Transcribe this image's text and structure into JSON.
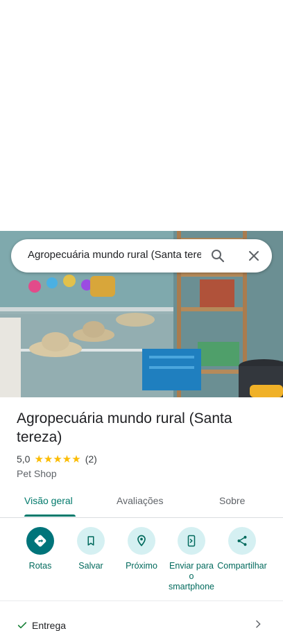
{
  "search": {
    "query": "Agropecuária mundo rural (Santa tere"
  },
  "place": {
    "name": "Agropecuária mundo rural (Santa tereza)",
    "rating": "5,0",
    "stars": "★★★★★",
    "reviews": "(2)",
    "category": "Pet Shop"
  },
  "tabs": [
    {
      "label": "Visão geral"
    },
    {
      "label": "Avaliações"
    },
    {
      "label": "Sobre"
    }
  ],
  "actions": [
    {
      "label": "Rotas",
      "icon": "directions-icon"
    },
    {
      "label": "Salvar",
      "icon": "bookmark-icon"
    },
    {
      "label": "Próximo",
      "icon": "nearby-icon"
    },
    {
      "label": "Enviar para o smartphone",
      "icon": "send-to-phone-icon"
    },
    {
      "label": "Compartilhar",
      "icon": "share-icon"
    }
  ],
  "attributes": [
    {
      "label": "Entrega",
      "icon": "check-icon"
    }
  ],
  "colors": {
    "accent": "#00796b",
    "action_bg": "#d5f0f2",
    "primary_btn": "#00747a",
    "star": "#fbbc04"
  }
}
